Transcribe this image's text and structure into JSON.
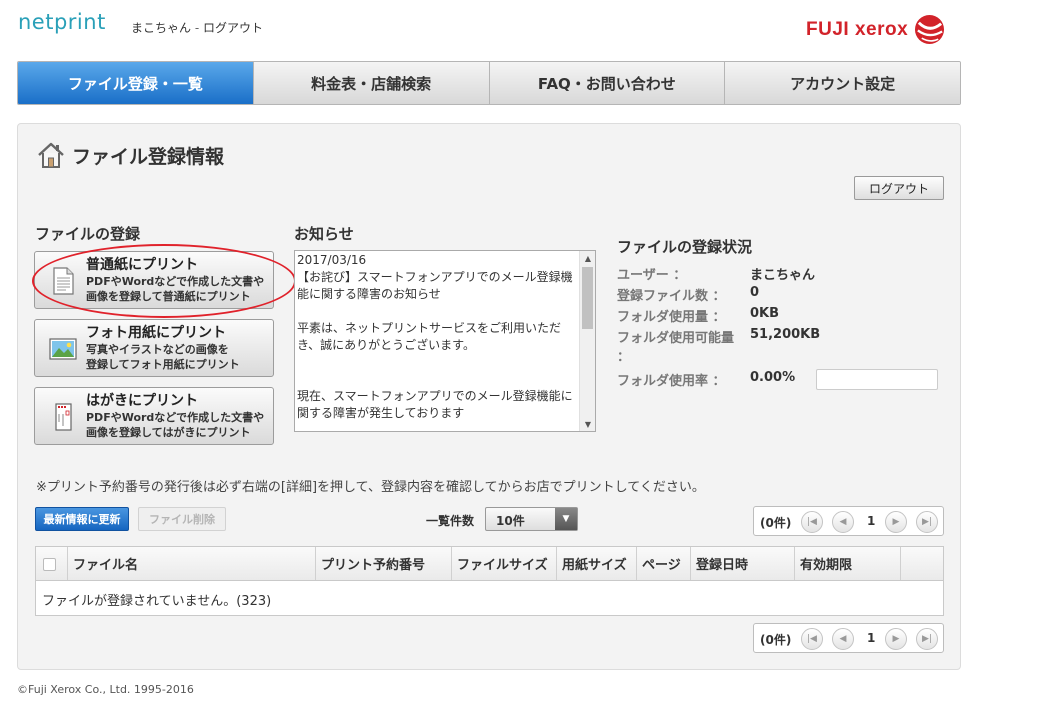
{
  "header": {
    "logo": "netprint",
    "username": "まこちゃん",
    "separator": " - ",
    "logout_link": "ログアウト",
    "brand": "FUJI xerox"
  },
  "nav": {
    "tabs": [
      {
        "label": "ファイル登録・一覧",
        "active": true
      },
      {
        "label": "料金表・店舗検索",
        "active": false
      },
      {
        "label": "FAQ・お問い合わせ",
        "active": false
      },
      {
        "label": "アカウント設定",
        "active": false
      }
    ]
  },
  "page": {
    "title": "ファイル登録情報",
    "logout_button": "ログアウト"
  },
  "register": {
    "heading": "ファイルの登録",
    "buttons": [
      {
        "title": "普通紙にプリント",
        "desc1": "PDFやWordなどで作成した文書や",
        "desc2": "画像を登録して普通紙にプリント",
        "icon": "document-icon"
      },
      {
        "title": "フォト用紙にプリント",
        "desc1": "写真やイラストなどの画像を",
        "desc2": "登録してフォト用紙にプリント",
        "icon": "photo-icon"
      },
      {
        "title": "はがきにプリント",
        "desc1": "PDFやWordなどで作成した文書や",
        "desc2": "画像を登録してはがきにプリント",
        "icon": "postcard-icon"
      }
    ]
  },
  "news": {
    "heading": "お知らせ",
    "content": "2017/03/16\n【お詫び】スマートフォンアプリでのメール登録機能に関する障害のお知らせ\n\n平素は、ネットプリントサービスをご利用いただき、誠にありがとうございます。\n\n\n現在、スマートフォンアプリでのメール登録機能に関する障害が発生しております"
  },
  "status": {
    "heading": "ファイルの登録状況",
    "rows": [
      {
        "label": "ユーザー ：",
        "value": "まこちゃん"
      },
      {
        "label": "登録ファイル数 ：",
        "value": "0"
      },
      {
        "label": "フォルダ使用量 ：",
        "value": "0KB"
      },
      {
        "label": "フォルダ使用可能量",
        "value": "51,200KB"
      },
      {
        "label": "：",
        "value": ""
      },
      {
        "label": "フォルダ使用率 ：",
        "value": "0.00%"
      }
    ],
    "usage_fraction": 0.0
  },
  "notice": "※プリント予約番号の発行後は必ず右端の[詳細]を押して、登録内容を確認してからお店でプリントしてください。",
  "toolbar": {
    "refresh": "最新情報に更新",
    "delete": "ファイル削除",
    "perpage_label": "一覧件数",
    "perpage_value": "10件"
  },
  "pager": {
    "count": "(0件)",
    "page": "1"
  },
  "table": {
    "columns": [
      "ファイル名",
      "プリント予約番号",
      "ファイルサイズ",
      "用紙サイズ",
      "ページ",
      "登録日時",
      "有効期限"
    ],
    "empty_message": "ファイルが登録されていません。(323)"
  },
  "footer": "©Fuji Xerox Co., Ltd. 1995-2016",
  "colors": {
    "accent": "#1a6fc8",
    "brand_red": "#d2232a",
    "logo_teal": "#2aa0b8",
    "highlight": "#e0222b"
  }
}
